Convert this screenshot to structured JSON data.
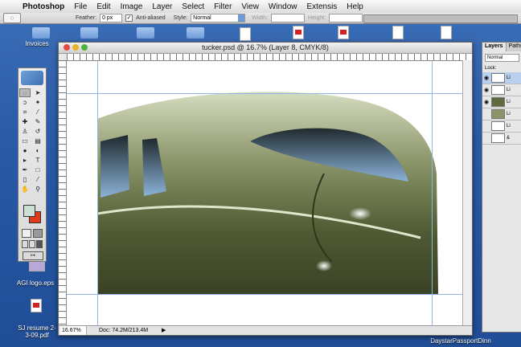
{
  "menubar": {
    "items": [
      "Photoshop",
      "File",
      "Edit",
      "Image",
      "Layer",
      "Select",
      "Filter",
      "View",
      "Window",
      "Extensis",
      "Help"
    ]
  },
  "options": {
    "feather_label": "Feather:",
    "feather_value": "0 px",
    "antialias_label": "Anti-aliased",
    "style_label": "Style:",
    "style_value": "Normal",
    "width_label": "Width:",
    "height_label": "Height:"
  },
  "desktop": {
    "icons": [
      {
        "label": "Invoices"
      },
      {
        "label": "AGI logo.eps"
      },
      {
        "label": "SJ resume 2-3-09.pdf"
      },
      {
        "label": "DaystarPassportDinn"
      }
    ]
  },
  "document": {
    "title": "tucker.psd @ 16.7% (Layer 8, CMYK/8)",
    "zoom": "16.67%",
    "doc_info": "Doc: 74.2M/213.4M"
  },
  "layers_panel": {
    "tabs": [
      "Layers",
      "Paths"
    ],
    "blend_mode": "Normal",
    "lock_label": "Lock:",
    "row_labels": [
      "Li",
      "Li",
      "Li",
      "Li",
      "Li",
      "&"
    ]
  },
  "colors": {
    "foreground": "#cde0d6",
    "background": "#e13a1a",
    "car_body": "#5f6a3e"
  }
}
